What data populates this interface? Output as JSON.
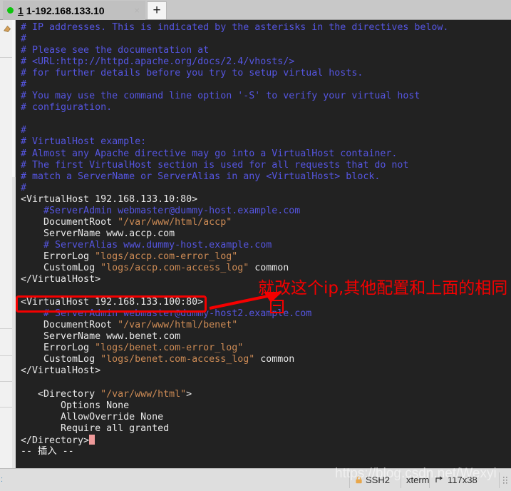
{
  "window": {
    "tab": {
      "index_label": "1",
      "title": "1-192.168.133.10",
      "close_label": "×",
      "status_dot_color": "#0ec40e"
    },
    "new_tab_label": "+"
  },
  "terminal": {
    "background_color": "#222222",
    "comment_color": "#5555e0",
    "string_color": "#cd8b55",
    "text_color": "#e8e8e8",
    "cursor_color": "#ef9a9a",
    "lines": [
      {
        "segments": [
          {
            "text": "# IP addresses. This is indicated by the asterisks in the directives below.",
            "cls": "c-comment"
          }
        ]
      },
      {
        "segments": [
          {
            "text": "#",
            "cls": "c-comment"
          }
        ]
      },
      {
        "segments": [
          {
            "text": "# Please see the documentation at",
            "cls": "c-comment"
          }
        ]
      },
      {
        "segments": [
          {
            "text": "# <URL:http://httpd.apache.org/docs/2.4/vhosts/>",
            "cls": "c-comment"
          }
        ]
      },
      {
        "segments": [
          {
            "text": "# for further details before you try to setup virtual hosts.",
            "cls": "c-comment"
          }
        ]
      },
      {
        "segments": [
          {
            "text": "#",
            "cls": "c-comment"
          }
        ]
      },
      {
        "segments": [
          {
            "text": "# You may use the command line option '-S' to verify your virtual host",
            "cls": "c-comment"
          }
        ]
      },
      {
        "segments": [
          {
            "text": "# configuration.",
            "cls": "c-comment"
          }
        ]
      },
      {
        "segments": [
          {
            "text": "",
            "cls": "c-plain"
          }
        ]
      },
      {
        "segments": [
          {
            "text": "#",
            "cls": "c-comment"
          }
        ]
      },
      {
        "segments": [
          {
            "text": "# VirtualHost example:",
            "cls": "c-comment"
          }
        ]
      },
      {
        "segments": [
          {
            "text": "# Almost any Apache directive may go into a VirtualHost container.",
            "cls": "c-comment"
          }
        ]
      },
      {
        "segments": [
          {
            "text": "# The first VirtualHost section is used for all requests that do not",
            "cls": "c-comment"
          }
        ]
      },
      {
        "segments": [
          {
            "text": "# match a ServerName or ServerAlias in any <VirtualHost> block.",
            "cls": "c-comment"
          }
        ]
      },
      {
        "segments": [
          {
            "text": "#",
            "cls": "c-comment"
          }
        ]
      },
      {
        "segments": [
          {
            "text": "<VirtualHost 192.168.133.10:80>",
            "cls": "c-plain"
          }
        ]
      },
      {
        "segments": [
          {
            "text": "    #ServerAdmin webmaster@dummy-host.example.com",
            "cls": "c-comment"
          }
        ]
      },
      {
        "segments": [
          {
            "text": "    DocumentRoot ",
            "cls": "c-plain"
          },
          {
            "text": "\"/var/www/html/accp\"",
            "cls": "c-string"
          }
        ]
      },
      {
        "segments": [
          {
            "text": "    ServerName www.accp.com",
            "cls": "c-plain"
          }
        ]
      },
      {
        "segments": [
          {
            "text": "    # ServerAlias www.dummy-host.example.com",
            "cls": "c-comment"
          }
        ]
      },
      {
        "segments": [
          {
            "text": "    ErrorLog ",
            "cls": "c-plain"
          },
          {
            "text": "\"logs/accp.com-error_log\"",
            "cls": "c-string"
          }
        ]
      },
      {
        "segments": [
          {
            "text": "    CustomLog ",
            "cls": "c-plain"
          },
          {
            "text": "\"logs/accp.com-access_log\"",
            "cls": "c-string"
          },
          {
            "text": " common",
            "cls": "c-plain"
          }
        ]
      },
      {
        "segments": [
          {
            "text": "</VirtualHost>",
            "cls": "c-plain"
          }
        ]
      },
      {
        "segments": [
          {
            "text": "",
            "cls": "c-plain"
          }
        ]
      },
      {
        "segments": [
          {
            "text": "<VirtualHost 192.168.133.100:80>",
            "cls": "c-plain"
          }
        ]
      },
      {
        "segments": [
          {
            "text": "    # ServerAdmin webmaster@dummy-host2.example.com",
            "cls": "c-comment"
          }
        ]
      },
      {
        "segments": [
          {
            "text": "    DocumentRoot ",
            "cls": "c-plain"
          },
          {
            "text": "\"/var/www/html/benet\"",
            "cls": "c-string"
          }
        ]
      },
      {
        "segments": [
          {
            "text": "    ServerName www.benet.com",
            "cls": "c-plain"
          }
        ]
      },
      {
        "segments": [
          {
            "text": "    ErrorLog ",
            "cls": "c-plain"
          },
          {
            "text": "\"logs/benet.com-error_log\"",
            "cls": "c-string"
          }
        ]
      },
      {
        "segments": [
          {
            "text": "    CustomLog ",
            "cls": "c-plain"
          },
          {
            "text": "\"logs/benet.com-access_log\"",
            "cls": "c-string"
          },
          {
            "text": " common",
            "cls": "c-plain"
          }
        ]
      },
      {
        "segments": [
          {
            "text": "</VirtualHost>",
            "cls": "c-plain"
          }
        ]
      },
      {
        "segments": [
          {
            "text": "",
            "cls": "c-plain"
          }
        ]
      },
      {
        "segments": [
          {
            "text": "   <Directory ",
            "cls": "c-plain"
          },
          {
            "text": "\"/var/www/html\"",
            "cls": "c-string"
          },
          {
            "text": ">",
            "cls": "c-plain"
          }
        ]
      },
      {
        "segments": [
          {
            "text": "       Options None",
            "cls": "c-plain"
          }
        ]
      },
      {
        "segments": [
          {
            "text": "       AllowOverride None",
            "cls": "c-plain"
          }
        ]
      },
      {
        "segments": [
          {
            "text": "       Require all granted",
            "cls": "c-plain"
          }
        ]
      },
      {
        "segments": [
          {
            "text": "</Directory>",
            "cls": "c-plain"
          },
          {
            "text": "",
            "cls": "cursor-slot"
          }
        ]
      },
      {
        "segments": [
          {
            "text": "-- 插入 --",
            "cls": "c-status"
          }
        ]
      }
    ]
  },
  "annotation": {
    "color": "#f50000",
    "text": "就改这个ip,其他配置和上面的相同",
    "highlighted_line": "<VirtualHost 192.168.133.100:80>"
  },
  "statusbar": {
    "protocol": "SSH2",
    "terminal_type": "xterm",
    "dimensions": "117x38",
    "watermark": "https://blog.csdn.net/Wexyi"
  }
}
